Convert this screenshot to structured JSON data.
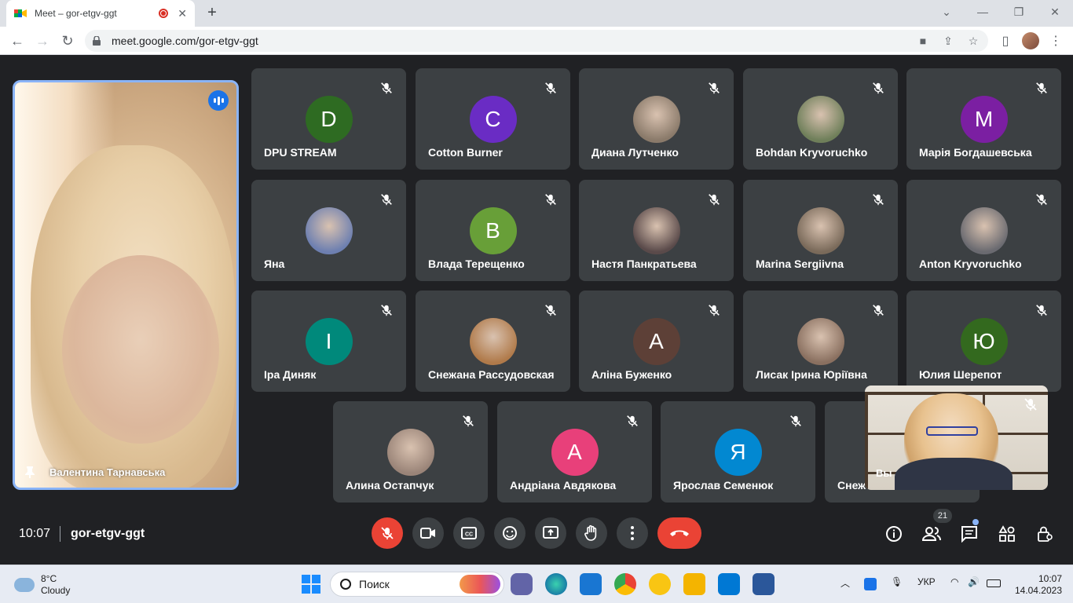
{
  "browser": {
    "tab_title": "Meet – gor-etgv-ggt",
    "url": "meet.google.com/gor-etgv-ggt"
  },
  "pinned": {
    "name": "Валентина Тарнавська"
  },
  "participants": [
    {
      "name": "DPU STREAM",
      "initial": "D",
      "color": "#2e6b22"
    },
    {
      "name": "Cotton Burner",
      "initial": "C",
      "color": "#6a2cc4"
    },
    {
      "name": "Диана Лутченко",
      "initial": "",
      "color": "#8a7a6a"
    },
    {
      "name": "Bohdan Kryvoruchko",
      "initial": "",
      "color": "#6f7f5a"
    },
    {
      "name": "Марія Богдашевська",
      "initial": "M",
      "color": "#7b1fa2"
    },
    {
      "name": "Яна",
      "initial": "",
      "color": "#6d7fb0"
    },
    {
      "name": "Влада Терещенко",
      "initial": "B",
      "color": "#689f38"
    },
    {
      "name": "Настя Панкратьева",
      "initial": "",
      "color": "#5a4a4a"
    },
    {
      "name": "Marina Sergiivna",
      "initial": "",
      "color": "#7a6a5a"
    },
    {
      "name": "Anton Kryvoruchko",
      "initial": "",
      "color": "#6a6a70"
    },
    {
      "name": "Іра Диняк",
      "initial": "I",
      "color": "#00897b"
    },
    {
      "name": "Снежана Рассудовская",
      "initial": "",
      "color": "#b07a4a"
    },
    {
      "name": "Аліна Буженко",
      "initial": "A",
      "color": "#5d4037"
    },
    {
      "name": "Лисак Ірина Юріївна",
      "initial": "",
      "color": "#8a7060"
    },
    {
      "name": "Юлия Шерепот",
      "initial": "Ю",
      "color": "#33691e"
    },
    {
      "name": "Алина Остапчук",
      "initial": "",
      "color": "#9a8478"
    },
    {
      "name": "Андріана Авдякова",
      "initial": "A",
      "color": "#e8407a"
    },
    {
      "name": "Ярослав Семенюк",
      "initial": "Я",
      "color": "#0288d1"
    },
    {
      "name": "Снеж",
      "initial": "",
      "color": "#3c4043"
    }
  ],
  "selfview": {
    "label": "Вы"
  },
  "bottom": {
    "time": "10:07",
    "meeting_code": "gor-etgv-ggt",
    "people_count": "21"
  },
  "taskbar": {
    "temperature": "8°C",
    "weather": "Cloudy",
    "search_placeholder": "Поиск",
    "language": "УКР",
    "time": "10:07",
    "date": "14.04.2023"
  },
  "colors": {
    "meet_bg": "#202124",
    "tile_bg": "#3c4043",
    "accent": "#8ab4f8",
    "end_call": "#ea4335"
  }
}
